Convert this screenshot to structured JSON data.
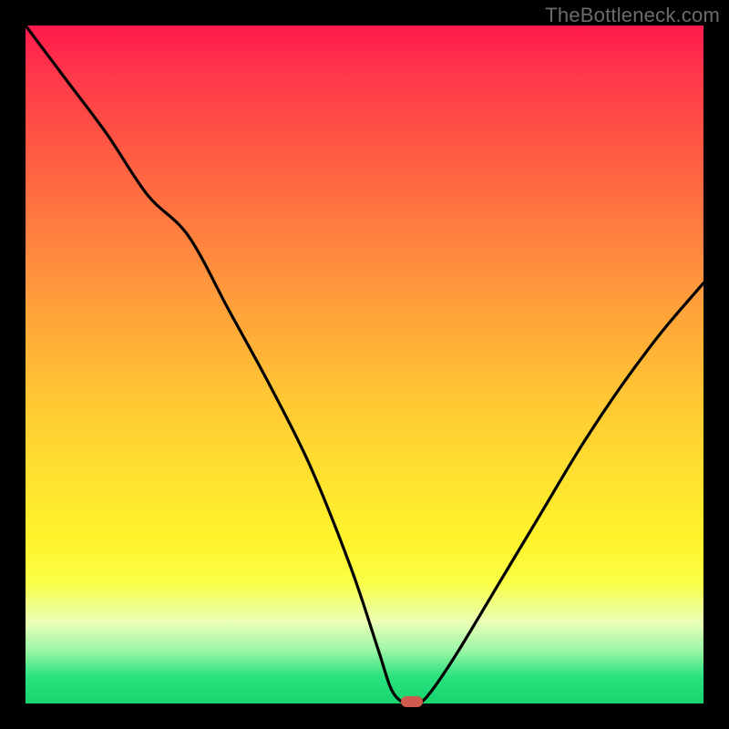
{
  "watermark": "TheBottleneck.com",
  "colors": {
    "frame": "#000000",
    "curve": "#000000",
    "marker": "#d1584f"
  },
  "chart_data": {
    "type": "line",
    "title": "",
    "xlabel": "",
    "ylabel": "",
    "xlim": [
      0,
      100
    ],
    "ylim": [
      0,
      100
    ],
    "grid": false,
    "background": "rainbow-vertical (red top to green bottom)",
    "series": [
      {
        "name": "bottleneck-curve",
        "x": [
          0,
          6,
          12,
          18,
          24,
          30,
          36,
          42,
          48,
          52,
          54,
          56,
          58,
          60,
          64,
          70,
          76,
          82,
          88,
          94,
          100
        ],
        "y": [
          100,
          92,
          84,
          75,
          69,
          58,
          47,
          35,
          20,
          8,
          2,
          0,
          0,
          2,
          8,
          18,
          28,
          38,
          47,
          55,
          62
        ]
      }
    ],
    "marker": {
      "x": 57,
      "y": 0
    }
  }
}
